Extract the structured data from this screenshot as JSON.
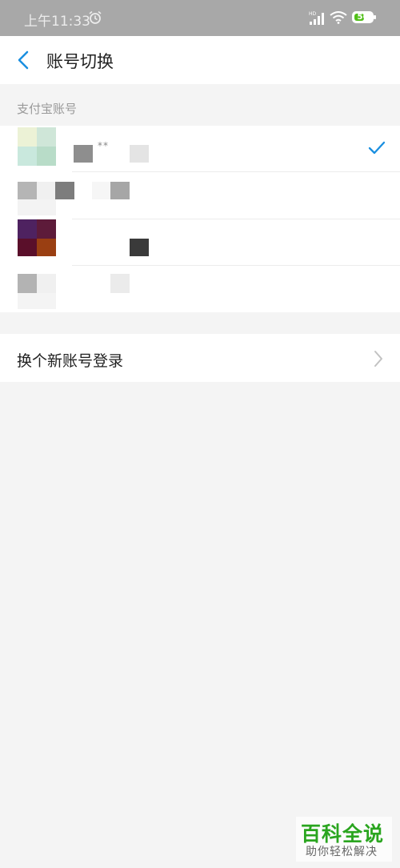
{
  "status_bar": {
    "time": "上午11:33",
    "battery_level": "56",
    "battery_fraction": 0.56,
    "icons": [
      "alarm-icon",
      "signal-icon",
      "wifi-icon",
      "battery-icon"
    ]
  },
  "nav": {
    "title": "账号切换",
    "back_icon": "chevron-left-icon"
  },
  "accounts_section": {
    "title": "支付宝账号",
    "accounts": [
      {
        "masked_id": "**",
        "selected": true
      },
      {
        "masked_id": "",
        "selected": false
      },
      {
        "masked_id": "",
        "selected": false
      },
      {
        "masked_id": "",
        "selected": false
      }
    ]
  },
  "new_login": {
    "label": "换个新账号登录",
    "icon": "chevron-right-icon"
  },
  "watermark": {
    "title": "百科全说",
    "subtitle": "助你轻松解决"
  },
  "colors": {
    "accent": "#1a8fe0",
    "status_bar_bg": "#a8a8a8",
    "page_bg": "#f4f4f4",
    "battery_green": "#52c01a",
    "watermark_green": "#2aa51f"
  }
}
